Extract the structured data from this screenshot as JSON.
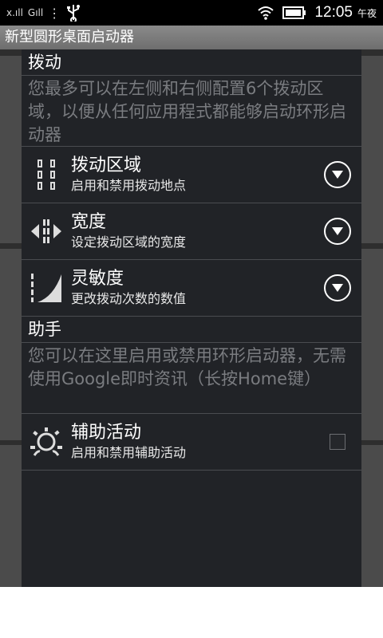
{
  "status_bar": {
    "carrier1": "x.ıll",
    "carrier2": "Gıll",
    "time": "12:05",
    "ampm": "午夜",
    "icons": [
      "signal-icon",
      "signal-icon",
      "usb-icon",
      "wifi-icon",
      "battery-icon"
    ]
  },
  "app_title": "新型圆形桌面启动器",
  "sections": {
    "swipe": {
      "header": "拨动",
      "description": "您最多可以在左侧和右侧配置6个拨动区域，以便从任何应用程式都能够启动环形启动器",
      "items": [
        {
          "title": "拨动区域",
          "subtitle": "启用和禁用拨动地点"
        },
        {
          "title": "宽度",
          "subtitle": "设定拨动区域的宽度"
        },
        {
          "title": "灵敏度",
          "subtitle": "更改拨动次数的数值"
        }
      ]
    },
    "assistant": {
      "header": "助手",
      "description": "您可以在这里启用或禁用环形启动器，无需使用Google即时资讯（长按Home键）",
      "items": [
        {
          "title": "辅助活动",
          "subtitle": "启用和禁用辅助活动",
          "checked": false
        }
      ]
    }
  },
  "colors": {
    "panel_bg": "#212327",
    "desc_text": "#7a7c80",
    "divider": "#4a4c50"
  }
}
